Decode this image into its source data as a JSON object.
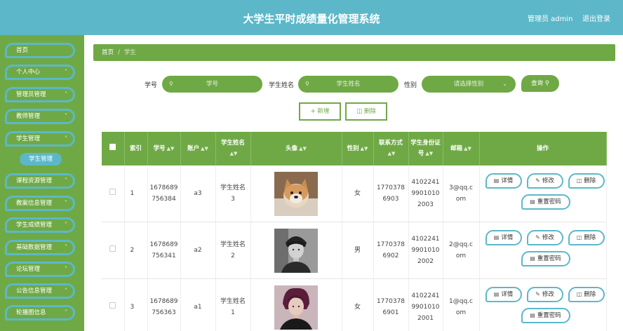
{
  "header": {
    "title": "大学生平时成绩量化管理系统",
    "user": "管理员 admin",
    "logout": "退出登录"
  },
  "sidebar": {
    "items": [
      {
        "label": "首页",
        "has_arrow": false
      },
      {
        "label": "个人中心",
        "has_arrow": true
      },
      {
        "label": "管理员管理",
        "has_arrow": true
      },
      {
        "label": "教师管理",
        "has_arrow": true
      },
      {
        "label": "学生管理",
        "has_arrow": true
      },
      {
        "label": "课程资源管理",
        "has_arrow": true
      },
      {
        "label": "教案信息管理",
        "has_arrow": true
      },
      {
        "label": "学生成绩管理",
        "has_arrow": true
      },
      {
        "label": "基础数据管理",
        "has_arrow": true
      },
      {
        "label": "论坛管理",
        "has_arrow": true
      },
      {
        "label": "公告信息管理",
        "has_arrow": true
      },
      {
        "label": "轮播图信息",
        "has_arrow": true
      }
    ],
    "sub_item": "学生管理"
  },
  "breadcrumb": {
    "home": "首页",
    "sep": "/",
    "current": "学生"
  },
  "search": {
    "id_label": "学号",
    "id_placeholder": "学号",
    "name_label": "学生姓名",
    "name_placeholder": "学生姓名",
    "gender_label": "性别",
    "gender_placeholder": "请选择性别",
    "query": "查询"
  },
  "actions": {
    "add": "新增",
    "delete": "删除"
  },
  "table": {
    "headers": {
      "index": "索引",
      "student_id": "学号",
      "account": "账户",
      "name": "学生姓名",
      "avatar": "头像",
      "gender": "性别",
      "phone": "联系方式",
      "id_card": "学生身份证号",
      "email": "邮箱",
      "ops": "操作"
    },
    "ops": {
      "detail": "详情",
      "edit": "修改",
      "delete": "删除",
      "reset": "重置密码"
    },
    "rows": [
      {
        "index": "1",
        "student_id": "1678689756384",
        "account": "a3",
        "name": "学生姓名3",
        "gender": "女",
        "phone": "17703786903",
        "id_card": "410224199010102003",
        "email": "3@qq.com"
      },
      {
        "index": "2",
        "student_id": "1678689756341",
        "account": "a2",
        "name": "学生姓名2",
        "gender": "男",
        "phone": "17703786902",
        "id_card": "410224199010102002",
        "email": "2@qq.com"
      },
      {
        "index": "3",
        "student_id": "1678689756363",
        "account": "a1",
        "name": "学生姓名1",
        "gender": "女",
        "phone": "17703786901",
        "id_card": "410224199010102001",
        "email": "1@qq.com"
      }
    ]
  },
  "colors": {
    "green": "#6fa945",
    "teal": "#5cb8c8"
  }
}
